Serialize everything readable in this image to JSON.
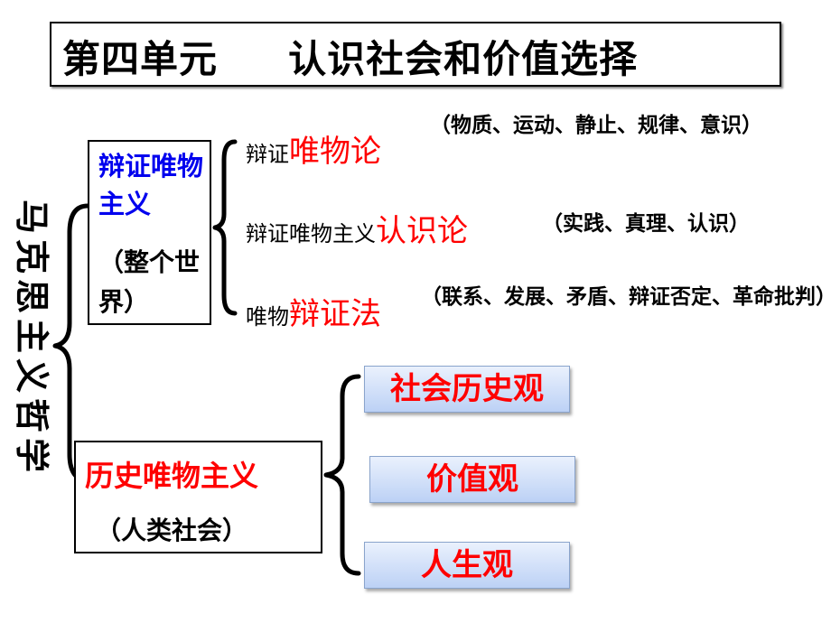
{
  "title": {
    "unit": "第四单元",
    "topic": "认识社会和价值选择"
  },
  "root": {
    "label": "马克思主义哲学"
  },
  "dialectical_materialism": {
    "title": "辩证唯物主义",
    "scope": "（整个世界）",
    "branches": [
      {
        "prefix": "辩证",
        "name": "唯物论",
        "note": "（物质、运动、静止、规律、意识）"
      },
      {
        "prefix": "辩证唯物主义",
        "name": "认识论",
        "note": "（实践、真理、认识）"
      },
      {
        "prefix": "唯物",
        "name": "辩证法",
        "note": "（联系、发展、矛盾、辩证否定、革命批判）"
      }
    ]
  },
  "historical_materialism": {
    "title": "历史唯物主义",
    "scope": "（人类社会）",
    "views": [
      "社会历史观",
      "价值观",
      "人生观"
    ]
  }
}
